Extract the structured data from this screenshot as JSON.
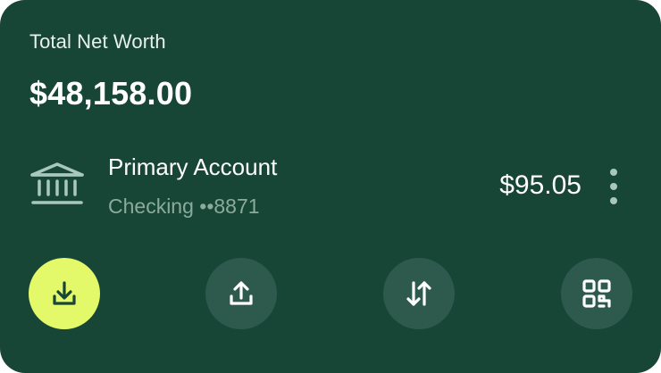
{
  "card": {
    "title": "Total Net Worth",
    "amount": "$48,158.00"
  },
  "account": {
    "icon": "bank-icon",
    "name": "Primary Account",
    "subtitle": "Checking ••8871",
    "balance": "$95.05",
    "menu_icon": "more-vertical-icon"
  },
  "actions": [
    {
      "icon": "download-icon",
      "primary": true
    },
    {
      "icon": "upload-icon",
      "primary": false
    },
    {
      "icon": "transfer-icon",
      "primary": false
    },
    {
      "icon": "qr-code-icon",
      "primary": false
    }
  ],
  "colors": {
    "card_background": "#174536",
    "button_background": "#2e5a4d",
    "primary_button": "#e3f96a",
    "muted_text": "#8bab9c"
  }
}
